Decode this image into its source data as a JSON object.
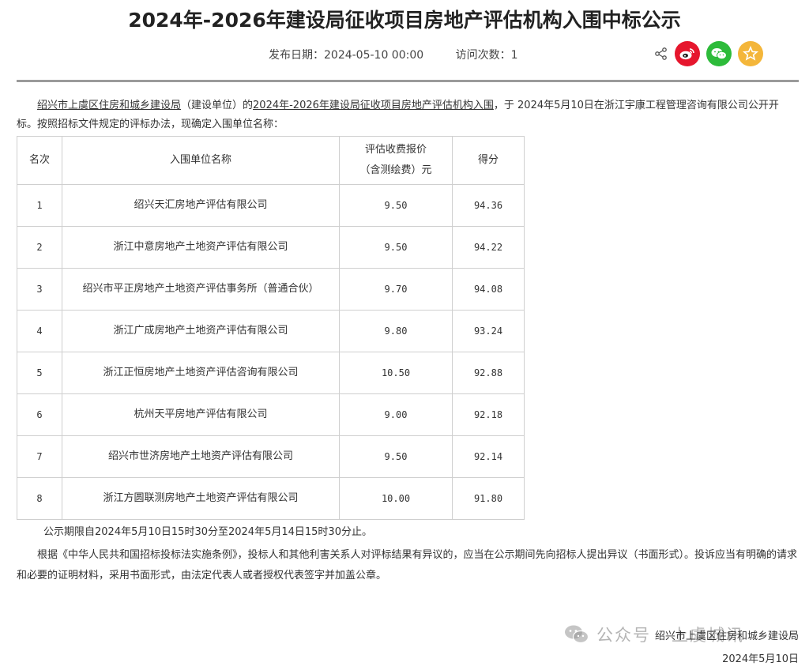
{
  "header": {
    "title": "2024年-2026年建设局征收项目房地产评估机构入围中标公示",
    "publish_label": "发布日期：",
    "publish_date": "2024-05-10 00:00",
    "visits_label": "访问次数：",
    "visits": "1"
  },
  "share_icons": [
    "share-icon",
    "weibo-icon",
    "wechat-icon",
    "favorite-icon"
  ],
  "intro": {
    "org_link": "绍兴市上虞区住房和城乡建设局",
    "part1": "（建设单位）的",
    "project_link": "2024年-2026年建设局征收项目房地产评估机构入围",
    "part2": "，于 2024年5月10日在浙江宇康工程管理咨询有限公司公开开标。按照招标文件规定的评标办法，现确定入围单位名称："
  },
  "table": {
    "headers": [
      "名次",
      "入围单位名称",
      "评估收费报价（含测绘费）元",
      "得分"
    ],
    "header_price_line1": "评估收费报价",
    "header_price_line2": "（含测绘费）元",
    "rows": [
      {
        "rank": "1",
        "name": "绍兴天汇房地产评估有限公司",
        "price": "9.50",
        "score": "94.36"
      },
      {
        "rank": "2",
        "name": "浙江中意房地产土地资产评估有限公司",
        "price": "9.50",
        "score": "94.22"
      },
      {
        "rank": "3",
        "name": "绍兴市平正房地产土地资产评估事务所（普通合伙）",
        "price": "9.70",
        "score": "94.08"
      },
      {
        "rank": "4",
        "name": "浙江广成房地产土地资产评估有限公司",
        "price": "9.80",
        "score": "93.24"
      },
      {
        "rank": "5",
        "name": "浙江正恒房地产土地资产评估咨询有限公司",
        "price": "10.50",
        "score": "92.88"
      },
      {
        "rank": "6",
        "name": "杭州天平房地产评估有限公司",
        "price": "9.00",
        "score": "92.18"
      },
      {
        "rank": "7",
        "name": "绍兴市世济房地产土地资产评估有限公司",
        "price": "9.50",
        "score": "92.14"
      },
      {
        "rank": "8",
        "name": "浙江方圆联测房地产土地资产评估有限公司",
        "price": "10.00",
        "score": "91.80"
      }
    ]
  },
  "notice_period": "公示期限自2024年5月10日15时30分至2024年5月14日15时30分止。",
  "objection_text": "根据《中华人民共和国招标投标法实施条例》，投标人和其他利害关系人对评标结果有异议的，应当在公示期间先向招标人提出异议（书面形式）。投诉应当有明确的请求和必要的证明材料，采用书面形式，由法定代表人或者授权代表签字并加盖公章。",
  "signature": {
    "org": "绍兴市上虞区住房和城乡建设局",
    "date": "2024年5月10日"
  },
  "watermark": "公众号 · 上虞城讯",
  "colors": {
    "weibo": "#e6162d",
    "wechat": "#2dbb3a",
    "favorite": "#f4b63a",
    "divider": "#9a9a9a"
  }
}
